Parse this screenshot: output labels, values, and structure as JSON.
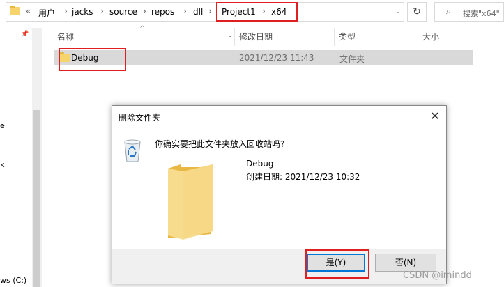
{
  "address": {
    "prefix": "«",
    "segments": [
      "用户",
      "jacks",
      "source",
      "repos",
      "dll",
      "Project1",
      "x64"
    ],
    "separator": "›",
    "dropdown": "⌄",
    "refresh": "↻"
  },
  "search": {
    "icon": "⌕",
    "placeholder": "搜索\"x64\""
  },
  "nav": {
    "pin": "📌",
    "fragment_e": "e",
    "fragment_k": "k",
    "drive_label": "ws (C:)"
  },
  "columns": {
    "name": "名称",
    "modified": "修改日期",
    "type": "类型",
    "size": "大小",
    "sort_caret": "^",
    "chevron": "⌄"
  },
  "files": [
    {
      "name": "Debug",
      "modified": "2021/12/23 11:43",
      "type": "文件夹"
    }
  ],
  "dialog": {
    "title": "删除文件夹",
    "close": "✕",
    "question": "你确实要把此文件夹放入回收站吗?",
    "item_name": "Debug",
    "item_created": "创建日期: 2021/12/23 10:32",
    "yes_label": "是(Y)",
    "no_label": "否(N)"
  },
  "watermark": "CSDN @imindd",
  "colors": {
    "highlight": "#e02020",
    "selection": "#d9d9d9",
    "accent": "#0078d7",
    "folder": "#f7d36b"
  }
}
